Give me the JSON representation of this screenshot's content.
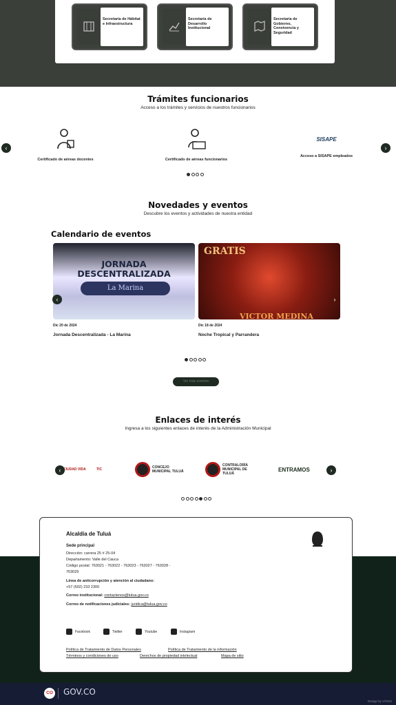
{
  "secretarias": [
    {
      "label": "Secretaría de Hábitat e Infraestructura",
      "icon": "building-icon"
    },
    {
      "label": "Secretaría de Desarrollo Institucional",
      "icon": "chart-icon"
    },
    {
      "label": "Secretaría de Gobierno, Convivencia y Seguridad",
      "icon": "map-icon"
    }
  ],
  "tramites": {
    "title": "Trámites funcionarios",
    "subtitle": "Acceso a los trámites y servicios de nuestros funcionarios",
    "items": [
      {
        "label": "Certificado de aéreas docentes",
        "icon": "teacher-icon"
      },
      {
        "label": "Certificado de aéreas funcionarios",
        "icon": "employee-icon"
      },
      {
        "label": "Acceso a SISAPE empleados",
        "icon": "sisape-logo",
        "logo_text": "SISAPE"
      }
    ]
  },
  "novedades": {
    "title": "Novedades y eventos",
    "subtitle": "Descubre los eventos y actividades de nuestra entidad"
  },
  "calendario": {
    "title": "Calendario de eventos",
    "events": [
      {
        "date": "Dic 20 de 2024",
        "name": "Jornada Descentralizada - La Marina",
        "image_text": "JORNADA DESCENTRALIZADA",
        "image_subtext": "La Marina"
      },
      {
        "date": "Dic 18 de 2024",
        "name": "Noche Tropical y Parrandera",
        "image_text": "GRATIS",
        "image_subtext": "VICTOR MEDINA"
      }
    ],
    "more_button": "Ver más eventos"
  },
  "enlaces": {
    "title": "Enlaces de interés",
    "subtitle": "Ingresa a los siguientes enlaces de interés de la Administración Municipal",
    "logos": [
      {
        "label": "CIUDAD VIDA"
      },
      {
        "label": "TIC"
      },
      {
        "label": "CONCEJO MUNICIPAL TULUÁ"
      },
      {
        "label": "CONTRALORÍA MUNICIPAL DE TULUÁ"
      },
      {
        "label": "ENTRAMOS"
      }
    ]
  },
  "footer": {
    "title": "Alcaldía de Tuluá",
    "sede": "Sede principal",
    "direccion": "Dirección: carrera 25 # 25-04",
    "departamento": "Departamento: Valle del Cauca",
    "codigo": "Código postal: 763021 - 763022 - 763023 - 763027 - 763028 -",
    "codigo2": "763029",
    "linea_label": "Línea de anticorrupción y atención al ciudadano:",
    "telefono": "+57 (602) 233 2300",
    "correo_label": "Correo institucional:",
    "correo": "contactenos@tulua.gov.co",
    "notif_label": "Correo de notificaciones judiciales:",
    "notif": "juridica@tulua.gov.co",
    "social": [
      "Facebook",
      "Twitter",
      "Youtube",
      "Instagram"
    ],
    "policies": [
      "Política de Tratamiento de Datos Personales",
      "Política de Tratamiento de la información",
      "Términos y condiciones de uso",
      "Derechos de propiedad intelectual",
      "Mapa de sitio"
    ]
  },
  "govbar": {
    "logo": "CO",
    "text": "GOV.CO",
    "small": "Design by VOISS"
  }
}
